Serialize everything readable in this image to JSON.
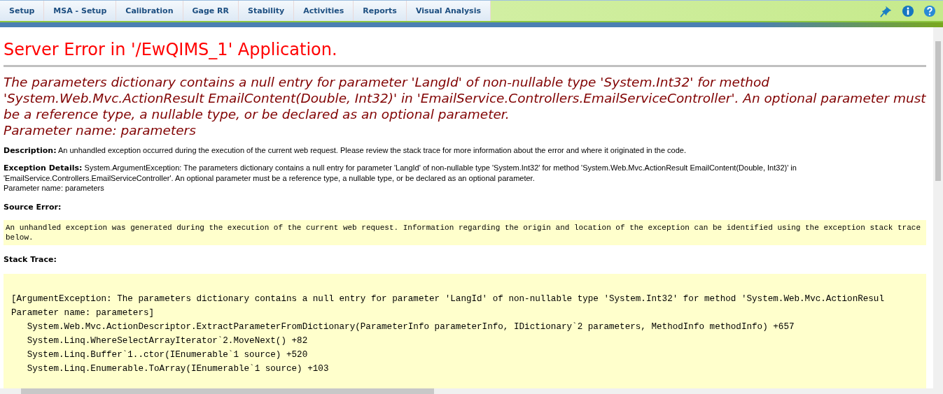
{
  "tabs": [
    {
      "label": "Setup",
      "selected": false
    },
    {
      "label": "MSA - Setup",
      "selected": false
    },
    {
      "label": "Calibration",
      "selected": false
    },
    {
      "label": "Gage RR",
      "selected": false
    },
    {
      "label": "Stability",
      "selected": false
    },
    {
      "label": "Activities",
      "selected": false
    },
    {
      "label": "Reports",
      "selected": false
    },
    {
      "label": "Visual Analysis",
      "selected": false
    }
  ],
  "error": {
    "title": "Server Error in '/EwQIMS_1' Application.",
    "message": "The parameters dictionary contains a null entry for parameter 'LangId' of non-nullable type 'System.Int32' for method 'System.Web.Mvc.ActionResult EmailContent(Double, Int32)' in 'EmailService.Controllers.EmailServiceController'. An optional parameter must be a reference type, a nullable type, or be declared as an optional parameter.",
    "parameter_line": "Parameter name: parameters",
    "description_label": "Description:",
    "description": "An unhandled exception occurred during the execution of the current web request. Please review the stack trace for more information about the error and where it originated in the code.",
    "details_label": "Exception Details:",
    "details": "System.ArgumentException: The parameters dictionary contains a null entry for parameter 'LangId' of non-nullable type 'System.Int32' for method 'System.Web.Mvc.ActionResult EmailContent(Double, Int32)' in 'EmailService.Controllers.EmailServiceController'. An optional parameter must be a reference type, a nullable type, or be declared as an optional parameter.",
    "details_parameter": "Parameter name: parameters",
    "source_label": "Source Error:",
    "source": "An unhandled exception was generated during the execution of the current web request. Information regarding the origin and location of the exception can be identified using the exception stack trace below.",
    "stack_label": "Stack Trace:",
    "stack_lines": [
      "[ArgumentException: The parameters dictionary contains a null entry for parameter 'LangId' of non-nullable type 'System.Int32' for method 'System.Web.Mvc.ActionResul",
      "Parameter name: parameters]",
      "   System.Web.Mvc.ActionDescriptor.ExtractParameterFromDictionary(ParameterInfo parameterInfo, IDictionary`2 parameters, MethodInfo methodInfo) +657",
      "   System.Linq.WhereSelectArrayIterator`2.MoveNext() +82",
      "   System.Linq.Buffer`1..ctor(IEnumerable`1 source) +520",
      "   System.Linq.Enumerable.ToArray(IEnumerable`1 source) +103"
    ]
  }
}
